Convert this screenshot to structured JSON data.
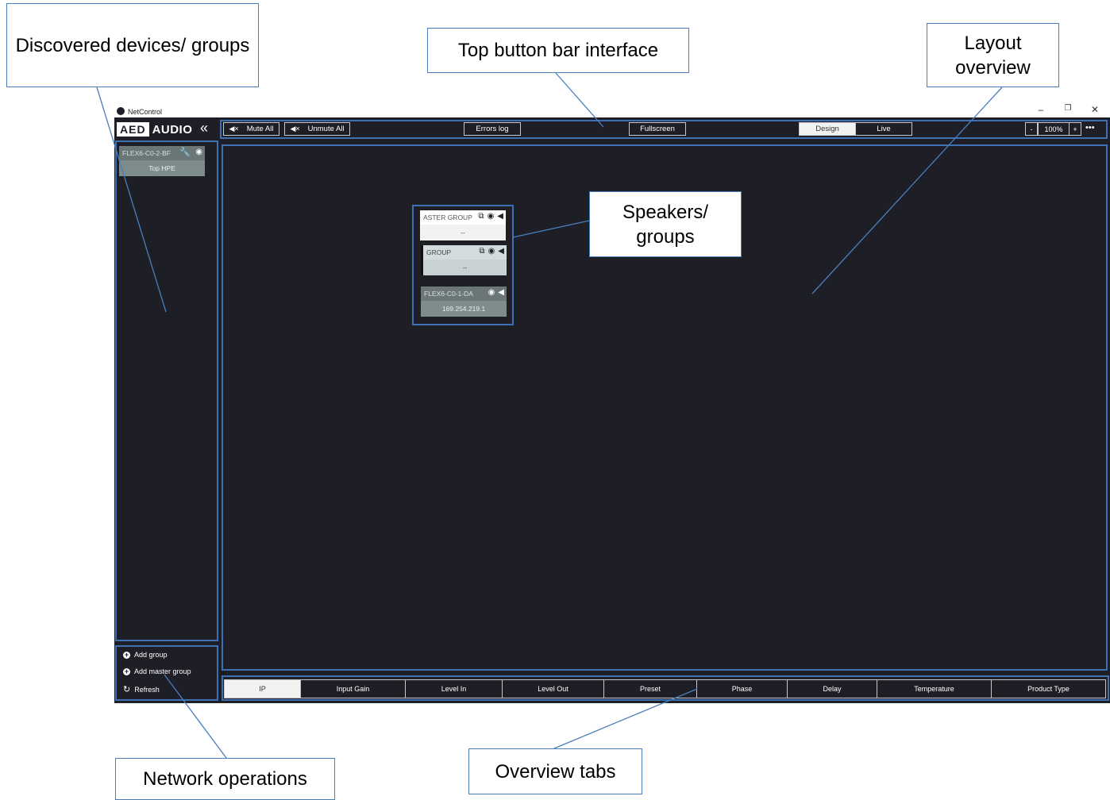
{
  "callouts": {
    "discovered": "Discovered devices/ groups",
    "top_bar": "Top button bar interface",
    "layout": "Layout overview",
    "speakers": "Speakers/ groups",
    "network": "Network operations",
    "tabs": "Overview tabs"
  },
  "window": {
    "title": "NetControl"
  },
  "logo": {
    "brand1": "AED",
    "brand2": "AUDIO"
  },
  "toolbar": {
    "mute_all": "Mute All",
    "unmute_all": "Unmute All",
    "errors_log": "Errors log",
    "fullscreen": "Fullscreen",
    "design": "Design",
    "live": "Live",
    "zoom_minus": "-",
    "zoom_value": "100%",
    "zoom_plus": "+",
    "more": "•••"
  },
  "sidebar": {
    "device": {
      "name": "FLEX6-C0-2-BF",
      "sub": "Top HPE"
    },
    "ops": {
      "add_group": "Add group",
      "add_master_group": "Add master group",
      "refresh": "Refresh"
    }
  },
  "canvas": {
    "master_group": {
      "name": "ASTER GROUP",
      "sub": "--"
    },
    "group": {
      "name": "GROUP",
      "sub": "--"
    },
    "speaker": {
      "name": "FLEX6-C0-1-DA",
      "sub": "169.254.219.1"
    }
  },
  "tabs": [
    "IP",
    "Input Gain",
    "Level In",
    "Level Out",
    "Preset",
    "Phase",
    "Delay",
    "Temperature",
    "Product Type"
  ],
  "colors": {
    "app_bg": "#1e1f26",
    "outline": "#3d6fb5",
    "card": "#7f8c8c"
  }
}
